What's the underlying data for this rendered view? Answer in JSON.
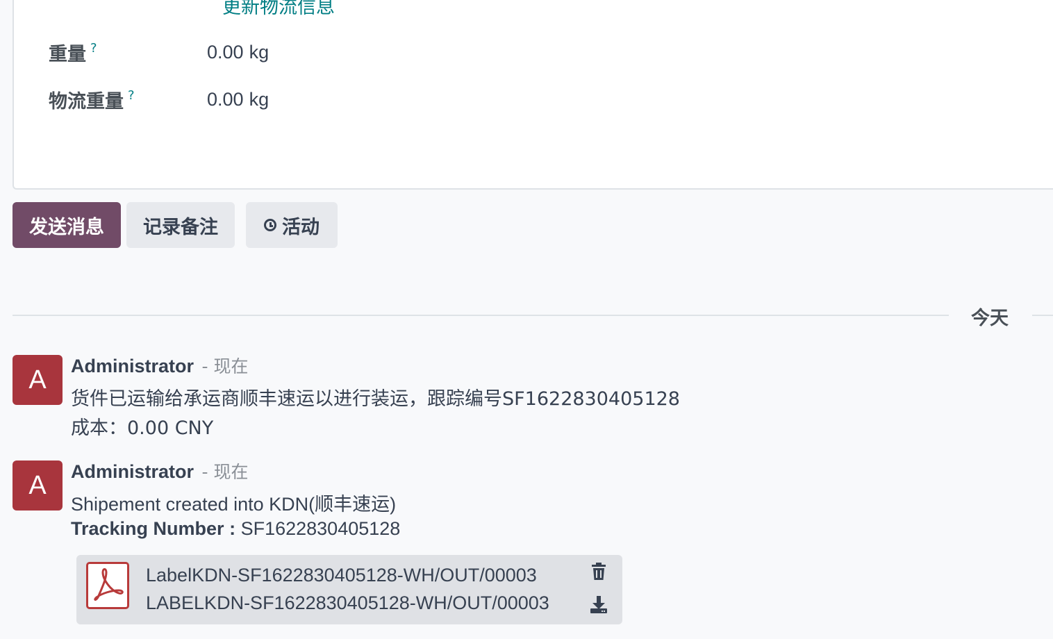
{
  "form": {
    "update_link": "更新物流信息",
    "help_mark": "?",
    "fields": [
      {
        "label": "重量",
        "value": "0.00",
        "unit": "kg"
      },
      {
        "label": "物流重量",
        "value": "0.00",
        "unit": "kg"
      }
    ]
  },
  "chatter": {
    "send_message": "发送消息",
    "log_note": "记录备注",
    "activity": "活动"
  },
  "separator": {
    "label": "今天"
  },
  "messages": [
    {
      "avatar_letter": "A",
      "author": "Administrator",
      "date": "- 现在",
      "line1": "货件已运输给承运商顺丰速运以进行装运，跟踪编号SF1622830405128",
      "line2": "成本：0.00 CNY"
    },
    {
      "avatar_letter": "A",
      "author": "Administrator",
      "date": "- 现在",
      "line1": "Shipement created into KDN(顺丰速运)",
      "tracking_label": "Tracking Number :",
      "tracking_value": "SF1622830405128"
    }
  ],
  "attachment": {
    "name": "LabelKDN-SF1622830405128-WH/OUT/00003",
    "subtitle": "LABELKDN-SF1622830405128-WH/OUT/00003",
    "icon": "pdf-icon"
  },
  "colors": {
    "primary": "#714b67",
    "avatar": "#a8353d",
    "link": "#017e84",
    "pdf": "#b83a3a"
  }
}
